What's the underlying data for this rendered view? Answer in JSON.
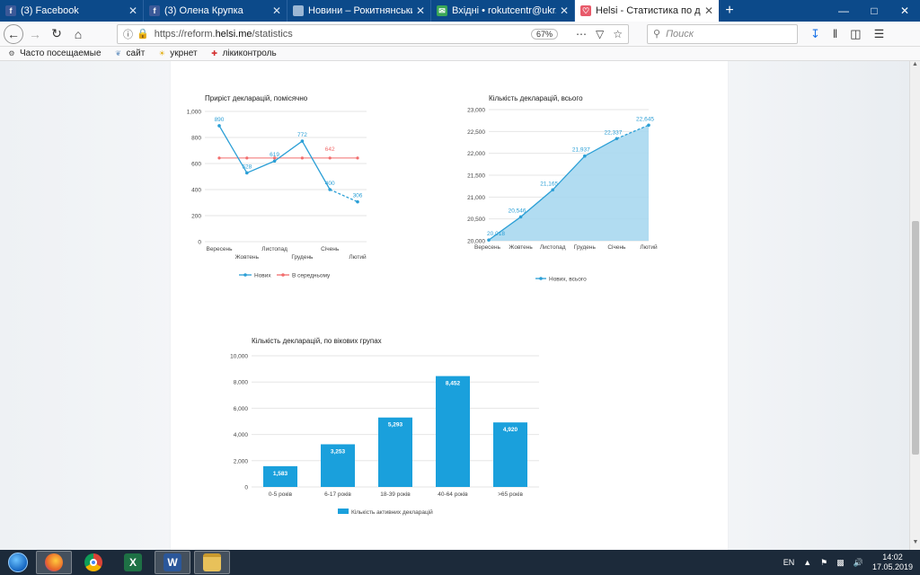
{
  "browser": {
    "tabs": [
      {
        "title": "(3) Facebook",
        "icon": "facebook-icon",
        "color": "#3b5998",
        "glyph": "f",
        "active": false
      },
      {
        "title": "(3) Олена Крупка",
        "icon": "facebook-icon",
        "color": "#3b5998",
        "glyph": "f",
        "active": false
      },
      {
        "title": "Новини – Рокитнянський Цен",
        "icon": "site-icon",
        "color": "#9bb7d4",
        "glyph": "",
        "active": false
      },
      {
        "title": "Вхідні • rokutcentr@ukr.net",
        "icon": "mail-icon",
        "color": "#3aa757",
        "glyph": "✉",
        "active": false
      },
      {
        "title": "Helsi - Статистика по декларац",
        "icon": "helsi-icon",
        "color": "#e85a6a",
        "glyph": "♡",
        "active": true
      }
    ],
    "url_prefix": "https://reform.",
    "url_domain": "helsi.me",
    "url_path": "/statistics",
    "zoom": "67%",
    "search_placeholder": "Поиск",
    "bookmarks": [
      {
        "label": "Часто посещаемые",
        "icon": "gear-icon"
      },
      {
        "label": "сайт",
        "icon": "leaf-icon"
      },
      {
        "label": "укрнет",
        "icon": "sun-icon"
      },
      {
        "label": "лікиконтроль",
        "icon": "pill-icon"
      }
    ]
  },
  "charts": {
    "growth": {
      "title": "Приріст декларацій, помісячно",
      "legend_new": "Нових",
      "legend_avg": "В середньому"
    },
    "total": {
      "title": "Кількість декларацій, всього",
      "legend": "Нових, всього"
    },
    "age": {
      "title": "Кількість декларацій, по вікових групах",
      "legend": "Кількість активних декларацій"
    }
  },
  "chart_data": [
    {
      "type": "line",
      "title": "Приріст декларацій, помісячно",
      "categories": [
        "Вересень",
        "Жовтень",
        "Листопад",
        "Грудень",
        "Січень",
        "Лютий"
      ],
      "ylim": [
        0,
        1000
      ],
      "yticks": [
        "0",
        "200",
        "400",
        "600",
        "800",
        "1,000"
      ],
      "series": [
        {
          "name": "Нових",
          "values": [
            890,
            528,
            619,
            772,
            400,
            306
          ],
          "color": "#2b9fd6"
        },
        {
          "name": "В середньому",
          "values": [
            642,
            642,
            642,
            642,
            642,
            642
          ],
          "color": "#f26d6d"
        }
      ],
      "labels_new": [
        "890",
        "528",
        "619",
        "772",
        "400",
        "306"
      ],
      "label_avg": "642",
      "legend": "bottom",
      "grid": true
    },
    {
      "type": "area",
      "title": "Кількість декларацій, всього",
      "categories": [
        "Вересень",
        "Жовтень",
        "Листопад",
        "Грудень",
        "Січень",
        "Лютий"
      ],
      "ylim": [
        20000,
        23000
      ],
      "yticks": [
        "20,000",
        "20,500",
        "21,000",
        "21,500",
        "22,000",
        "22,500",
        "23,000"
      ],
      "series": [
        {
          "name": "Нових, всього",
          "values": [
            20018,
            20546,
            21165,
            21937,
            22337,
            22645
          ],
          "color": "#2b9fd6"
        }
      ],
      "labels": [
        "20,018",
        "20,546",
        "21,165",
        "21,937",
        "22,337",
        "22,645"
      ],
      "legend": "bottom",
      "grid": true
    },
    {
      "type": "bar",
      "title": "Кількість декларацій, по вікових групах",
      "categories": [
        "0-5 років",
        "6-17 років",
        "18-39 років",
        "40-64 років",
        ">65 років"
      ],
      "ylim": [
        0,
        10000
      ],
      "yticks": [
        "0",
        "2,000",
        "4,000",
        "6,000",
        "8,000",
        "10,000"
      ],
      "series": [
        {
          "name": "Кількість активних декларацій",
          "values": [
            1583,
            3253,
            5293,
            8452,
            4920
          ],
          "color": "#1aa0dc"
        }
      ],
      "labels": [
        "1,583",
        "3,253",
        "5,293",
        "8,452",
        "4,920"
      ],
      "legend": "bottom",
      "grid": true
    }
  ],
  "taskbar": {
    "items": [
      {
        "name": "firefox-taskbar-button",
        "color": "#e8652a",
        "glyph": "🦊",
        "active": true
      },
      {
        "name": "chrome-taskbar-button",
        "color": "#ffffff",
        "glyph": "",
        "active": false
      },
      {
        "name": "excel-taskbar-button",
        "color": "#1e7145",
        "glyph": "X",
        "active": false
      },
      {
        "name": "word-taskbar-button",
        "color": "#2b579a",
        "glyph": "W",
        "active": true
      },
      {
        "name": "explorer-taskbar-button",
        "color": "#e8c15a",
        "glyph": "",
        "active": true
      }
    ],
    "lang": "EN",
    "time": "14:02",
    "date": "17.05.2019"
  }
}
